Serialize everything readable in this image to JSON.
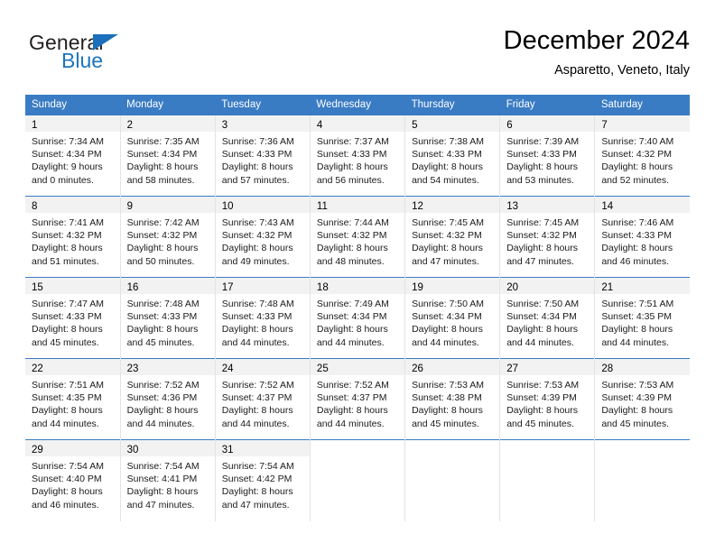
{
  "brand": {
    "name_primary": "General",
    "name_secondary": "Blue",
    "flag_color": "#1c6fba",
    "secondary_color": "#1c75bc"
  },
  "header": {
    "month_title": "December 2024",
    "location": "Asparetto, Veneto, Italy"
  },
  "colors": {
    "header_blue": "#3a7cc4",
    "daynum_band": "#f2f2f2",
    "grid_line": "#e3e3e3"
  },
  "weekday_headers": [
    "Sunday",
    "Monday",
    "Tuesday",
    "Wednesday",
    "Thursday",
    "Friday",
    "Saturday"
  ],
  "weeks": [
    [
      {
        "day": "1",
        "sunrise": "Sunrise: 7:34 AM",
        "sunset": "Sunset: 4:34 PM",
        "daylight_1": "Daylight: 9 hours",
        "daylight_2": "and 0 minutes."
      },
      {
        "day": "2",
        "sunrise": "Sunrise: 7:35 AM",
        "sunset": "Sunset: 4:34 PM",
        "daylight_1": "Daylight: 8 hours",
        "daylight_2": "and 58 minutes."
      },
      {
        "day": "3",
        "sunrise": "Sunrise: 7:36 AM",
        "sunset": "Sunset: 4:33 PM",
        "daylight_1": "Daylight: 8 hours",
        "daylight_2": "and 57 minutes."
      },
      {
        "day": "4",
        "sunrise": "Sunrise: 7:37 AM",
        "sunset": "Sunset: 4:33 PM",
        "daylight_1": "Daylight: 8 hours",
        "daylight_2": "and 56 minutes."
      },
      {
        "day": "5",
        "sunrise": "Sunrise: 7:38 AM",
        "sunset": "Sunset: 4:33 PM",
        "daylight_1": "Daylight: 8 hours",
        "daylight_2": "and 54 minutes."
      },
      {
        "day": "6",
        "sunrise": "Sunrise: 7:39 AM",
        "sunset": "Sunset: 4:33 PM",
        "daylight_1": "Daylight: 8 hours",
        "daylight_2": "and 53 minutes."
      },
      {
        "day": "7",
        "sunrise": "Sunrise: 7:40 AM",
        "sunset": "Sunset: 4:32 PM",
        "daylight_1": "Daylight: 8 hours",
        "daylight_2": "and 52 minutes."
      }
    ],
    [
      {
        "day": "8",
        "sunrise": "Sunrise: 7:41 AM",
        "sunset": "Sunset: 4:32 PM",
        "daylight_1": "Daylight: 8 hours",
        "daylight_2": "and 51 minutes."
      },
      {
        "day": "9",
        "sunrise": "Sunrise: 7:42 AM",
        "sunset": "Sunset: 4:32 PM",
        "daylight_1": "Daylight: 8 hours",
        "daylight_2": "and 50 minutes."
      },
      {
        "day": "10",
        "sunrise": "Sunrise: 7:43 AM",
        "sunset": "Sunset: 4:32 PM",
        "daylight_1": "Daylight: 8 hours",
        "daylight_2": "and 49 minutes."
      },
      {
        "day": "11",
        "sunrise": "Sunrise: 7:44 AM",
        "sunset": "Sunset: 4:32 PM",
        "daylight_1": "Daylight: 8 hours",
        "daylight_2": "and 48 minutes."
      },
      {
        "day": "12",
        "sunrise": "Sunrise: 7:45 AM",
        "sunset": "Sunset: 4:32 PM",
        "daylight_1": "Daylight: 8 hours",
        "daylight_2": "and 47 minutes."
      },
      {
        "day": "13",
        "sunrise": "Sunrise: 7:45 AM",
        "sunset": "Sunset: 4:32 PM",
        "daylight_1": "Daylight: 8 hours",
        "daylight_2": "and 47 minutes."
      },
      {
        "day": "14",
        "sunrise": "Sunrise: 7:46 AM",
        "sunset": "Sunset: 4:33 PM",
        "daylight_1": "Daylight: 8 hours",
        "daylight_2": "and 46 minutes."
      }
    ],
    [
      {
        "day": "15",
        "sunrise": "Sunrise: 7:47 AM",
        "sunset": "Sunset: 4:33 PM",
        "daylight_1": "Daylight: 8 hours",
        "daylight_2": "and 45 minutes."
      },
      {
        "day": "16",
        "sunrise": "Sunrise: 7:48 AM",
        "sunset": "Sunset: 4:33 PM",
        "daylight_1": "Daylight: 8 hours",
        "daylight_2": "and 45 minutes."
      },
      {
        "day": "17",
        "sunrise": "Sunrise: 7:48 AM",
        "sunset": "Sunset: 4:33 PM",
        "daylight_1": "Daylight: 8 hours",
        "daylight_2": "and 44 minutes."
      },
      {
        "day": "18",
        "sunrise": "Sunrise: 7:49 AM",
        "sunset": "Sunset: 4:34 PM",
        "daylight_1": "Daylight: 8 hours",
        "daylight_2": "and 44 minutes."
      },
      {
        "day": "19",
        "sunrise": "Sunrise: 7:50 AM",
        "sunset": "Sunset: 4:34 PM",
        "daylight_1": "Daylight: 8 hours",
        "daylight_2": "and 44 minutes."
      },
      {
        "day": "20",
        "sunrise": "Sunrise: 7:50 AM",
        "sunset": "Sunset: 4:34 PM",
        "daylight_1": "Daylight: 8 hours",
        "daylight_2": "and 44 minutes."
      },
      {
        "day": "21",
        "sunrise": "Sunrise: 7:51 AM",
        "sunset": "Sunset: 4:35 PM",
        "daylight_1": "Daylight: 8 hours",
        "daylight_2": "and 44 minutes."
      }
    ],
    [
      {
        "day": "22",
        "sunrise": "Sunrise: 7:51 AM",
        "sunset": "Sunset: 4:35 PM",
        "daylight_1": "Daylight: 8 hours",
        "daylight_2": "and 44 minutes."
      },
      {
        "day": "23",
        "sunrise": "Sunrise: 7:52 AM",
        "sunset": "Sunset: 4:36 PM",
        "daylight_1": "Daylight: 8 hours",
        "daylight_2": "and 44 minutes."
      },
      {
        "day": "24",
        "sunrise": "Sunrise: 7:52 AM",
        "sunset": "Sunset: 4:37 PM",
        "daylight_1": "Daylight: 8 hours",
        "daylight_2": "and 44 minutes."
      },
      {
        "day": "25",
        "sunrise": "Sunrise: 7:52 AM",
        "sunset": "Sunset: 4:37 PM",
        "daylight_1": "Daylight: 8 hours",
        "daylight_2": "and 44 minutes."
      },
      {
        "day": "26",
        "sunrise": "Sunrise: 7:53 AM",
        "sunset": "Sunset: 4:38 PM",
        "daylight_1": "Daylight: 8 hours",
        "daylight_2": "and 45 minutes."
      },
      {
        "day": "27",
        "sunrise": "Sunrise: 7:53 AM",
        "sunset": "Sunset: 4:39 PM",
        "daylight_1": "Daylight: 8 hours",
        "daylight_2": "and 45 minutes."
      },
      {
        "day": "28",
        "sunrise": "Sunrise: 7:53 AM",
        "sunset": "Sunset: 4:39 PM",
        "daylight_1": "Daylight: 8 hours",
        "daylight_2": "and 45 minutes."
      }
    ],
    [
      {
        "day": "29",
        "sunrise": "Sunrise: 7:54 AM",
        "sunset": "Sunset: 4:40 PM",
        "daylight_1": "Daylight: 8 hours",
        "daylight_2": "and 46 minutes."
      },
      {
        "day": "30",
        "sunrise": "Sunrise: 7:54 AM",
        "sunset": "Sunset: 4:41 PM",
        "daylight_1": "Daylight: 8 hours",
        "daylight_2": "and 47 minutes."
      },
      {
        "day": "31",
        "sunrise": "Sunrise: 7:54 AM",
        "sunset": "Sunset: 4:42 PM",
        "daylight_1": "Daylight: 8 hours",
        "daylight_2": "and 47 minutes."
      },
      {
        "day": "",
        "sunrise": "",
        "sunset": "",
        "daylight_1": "",
        "daylight_2": ""
      },
      {
        "day": "",
        "sunrise": "",
        "sunset": "",
        "daylight_1": "",
        "daylight_2": ""
      },
      {
        "day": "",
        "sunrise": "",
        "sunset": "",
        "daylight_1": "",
        "daylight_2": ""
      },
      {
        "day": "",
        "sunrise": "",
        "sunset": "",
        "daylight_1": "",
        "daylight_2": ""
      }
    ]
  ]
}
